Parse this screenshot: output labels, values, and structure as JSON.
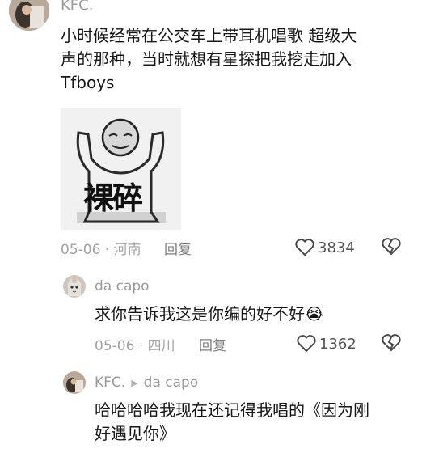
{
  "comment": {
    "author": "KFC.",
    "text_line1": "小时候经常在公交车上带耳机唱歌 超级大",
    "text_line2": "声的那种，当时就想有星探把我挖走加入",
    "text_line3": "Tfboys",
    "sticker_text": "裸碎",
    "date": "05-06",
    "location": "河南",
    "reply_label": "回复",
    "likes": "3834"
  },
  "replies": [
    {
      "author": "da capo",
      "text": "求你告诉我这是你编的好不好😭",
      "date": "05-06",
      "location": "四川",
      "reply_label": "回复",
      "likes": "1362"
    },
    {
      "author": "KFC.",
      "reply_to": "da capo",
      "text_line1": "哈哈哈哈我现在还记得我唱的《因为刚",
      "text_line2": "好遇见你》"
    }
  ]
}
